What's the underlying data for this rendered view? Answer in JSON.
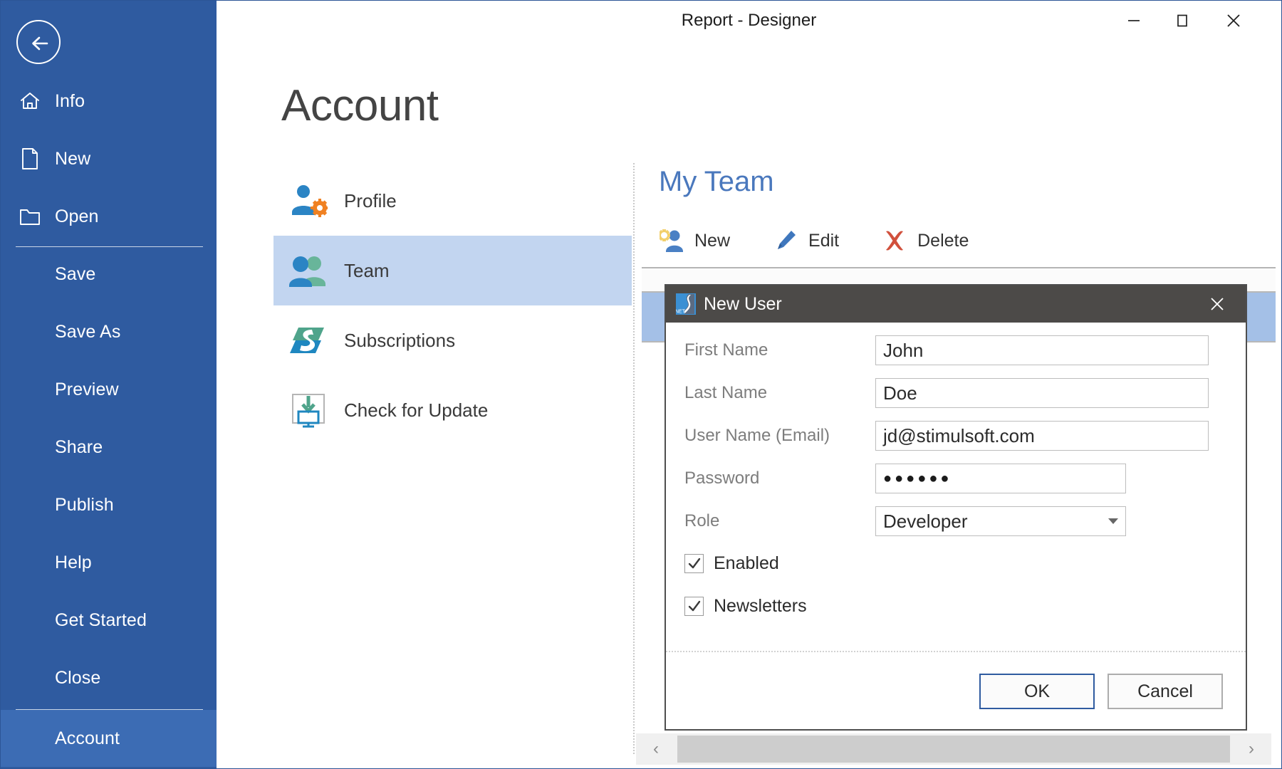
{
  "window": {
    "title": "Report - Designer",
    "minimize_label": "—",
    "maximize_label": "☐",
    "close_label": "✕"
  },
  "sidebar": {
    "back_icon": "back-arrow-icon",
    "items": [
      {
        "label": "Info",
        "icon": "home-icon",
        "type": "icon",
        "selected": false
      },
      {
        "label": "New",
        "icon": "page-icon",
        "type": "icon",
        "selected": false
      },
      {
        "label": "Open",
        "icon": "folder-icon",
        "type": "icon",
        "selected": false
      },
      {
        "label": "Save",
        "icon": "",
        "type": "text",
        "selected": false
      },
      {
        "label": "Save As",
        "icon": "",
        "type": "text",
        "selected": false
      },
      {
        "label": "Preview",
        "icon": "",
        "type": "text",
        "selected": false
      },
      {
        "label": "Share",
        "icon": "",
        "type": "text",
        "selected": false
      },
      {
        "label": "Publish",
        "icon": "",
        "type": "text",
        "selected": false
      },
      {
        "label": "Help",
        "icon": "",
        "type": "text",
        "selected": false
      },
      {
        "label": "Get Started",
        "icon": "",
        "type": "text",
        "selected": false
      },
      {
        "label": "Close",
        "icon": "",
        "type": "text",
        "selected": false
      },
      {
        "label": "Account",
        "icon": "",
        "type": "text",
        "selected": true
      }
    ],
    "accent": "#2f5ba0",
    "selected_bg": "#3c6cb4"
  },
  "page": {
    "title": "Account"
  },
  "categories": [
    {
      "label": "Profile",
      "icon": "user-settings-icon",
      "active": false
    },
    {
      "label": "Team",
      "icon": "two-users-icon",
      "active": true
    },
    {
      "label": "Subscriptions",
      "icon": "stimulsoft-s-icon",
      "active": false
    },
    {
      "label": "Check for Update",
      "icon": "download-pc-icon",
      "active": false
    }
  ],
  "team": {
    "title": "My Team",
    "title_color": "#4a78bd",
    "toolbar": [
      {
        "label": "New",
        "icon": "add-user-icon"
      },
      {
        "label": "Edit",
        "icon": "pencil-icon"
      },
      {
        "label": "Delete",
        "icon": "red-x-icon"
      }
    ]
  },
  "scrollbar": {
    "left_arrow": "‹",
    "right_arrow": "›"
  },
  "dialog": {
    "title": "New User",
    "logo_icon": "stimulsoft-net-logo-icon",
    "close_label": "✕",
    "fields": [
      {
        "label": "First Name",
        "value": "John",
        "kind": "text"
      },
      {
        "label": "Last Name",
        "value": "Doe",
        "kind": "text"
      },
      {
        "label": "User Name (Email)",
        "value": "jd@stimulsoft.com",
        "kind": "text"
      },
      {
        "label": "Password",
        "value": "●●●●●●",
        "kind": "password"
      },
      {
        "label": "Role",
        "value": "Developer",
        "kind": "select"
      }
    ],
    "checkboxes": [
      {
        "label": "Enabled",
        "checked": true
      },
      {
        "label": "Newsletters",
        "checked": true
      }
    ],
    "buttons": {
      "ok": "OK",
      "cancel": "Cancel"
    }
  }
}
